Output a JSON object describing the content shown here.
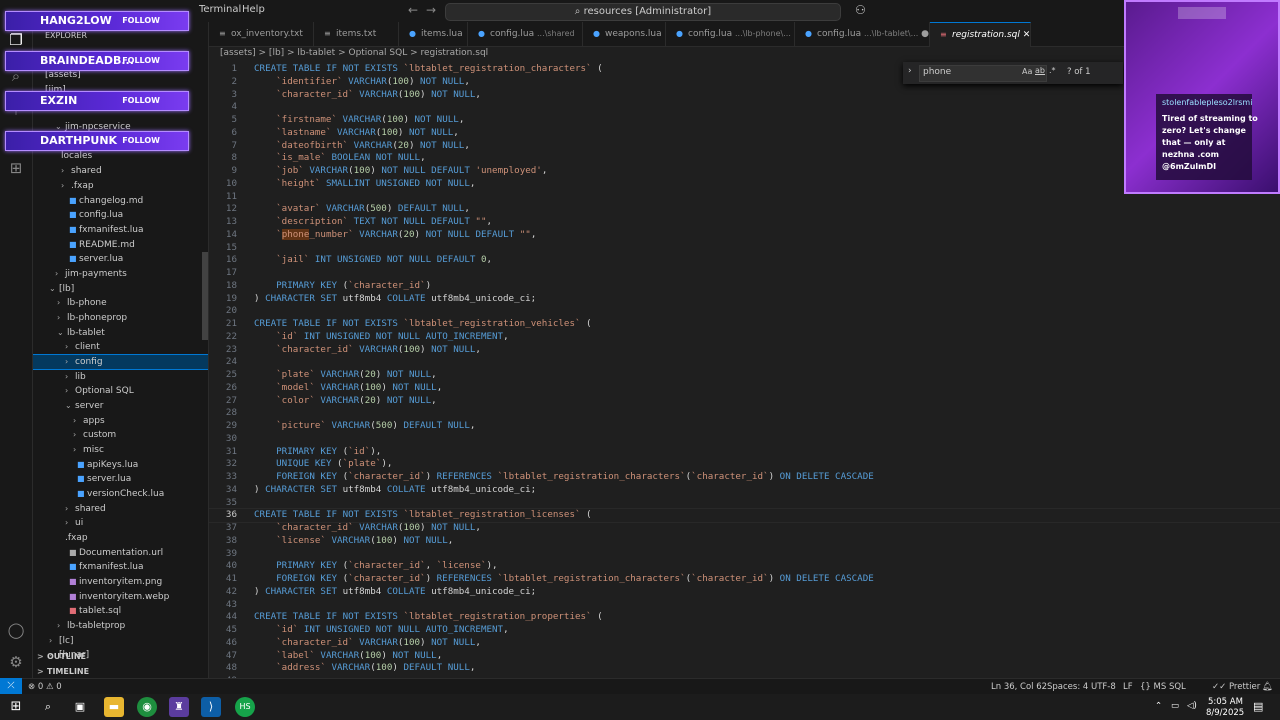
{
  "menu": {
    "terminal": "Terminal",
    "help": "Help"
  },
  "command_center": "resources [Administrator]",
  "follow_banners": [
    {
      "name": "HANG2LOW",
      "follow": "FOLLOW"
    },
    {
      "name": "BRAINDEADB...",
      "follow": "FOLLOW"
    },
    {
      "name": "EXZIN",
      "follow": "FOLLOW"
    },
    {
      "name": "DARTHPUNK",
      "follow": "FOLLOW"
    }
  ],
  "sidebar": {
    "title": "EXPLORER",
    "rows": [
      {
        "label": "[assets]",
        "icon": "",
        "chev": ""
      },
      {
        "label": "[jim]",
        "icon": "",
        "chev": ""
      },
      {
        "label": "jim-npcservice",
        "icon": "",
        "chev": "v"
      },
      {
        "label": "locales",
        "icon": "",
        "chev": ""
      },
      {
        "label": "shared",
        "icon": "",
        "chev": ">"
      },
      {
        "label": ".fxap",
        "icon": "",
        "chev": ">"
      },
      {
        "label": "changelog.md",
        "icon": "i",
        "chev": ""
      },
      {
        "label": "config.lua",
        "icon": "i",
        "chev": ""
      },
      {
        "label": "fxmanifest.lua",
        "icon": "i",
        "chev": ""
      },
      {
        "label": "README.md",
        "icon": "i",
        "chev": ""
      },
      {
        "label": "server.lua",
        "icon": "i",
        "chev": ""
      },
      {
        "label": "jim-payments",
        "icon": "",
        "chev": ">"
      },
      {
        "label": "[lb]",
        "icon": "",
        "chev": "v"
      },
      {
        "label": "lb-phone",
        "icon": "",
        "chev": ">"
      },
      {
        "label": "lb-phoneprop",
        "icon": "",
        "chev": ">"
      },
      {
        "label": "lb-tablet",
        "icon": "",
        "chev": "v"
      },
      {
        "label": "client",
        "icon": "",
        "chev": ">"
      },
      {
        "label": "config",
        "icon": "",
        "chev": ">"
      },
      {
        "label": "lib",
        "icon": "",
        "chev": ">"
      },
      {
        "label": "Optional SQL",
        "icon": "",
        "chev": ">"
      },
      {
        "label": "server",
        "icon": "",
        "chev": "v"
      },
      {
        "label": "apps",
        "icon": "",
        "chev": ">"
      },
      {
        "label": "custom",
        "icon": "",
        "chev": ">"
      },
      {
        "label": "misc",
        "icon": "",
        "chev": ">"
      },
      {
        "label": "apiKeys.lua",
        "icon": "i",
        "chev": ""
      },
      {
        "label": "server.lua",
        "icon": "i",
        "chev": ""
      },
      {
        "label": "versionCheck.lua",
        "icon": "i",
        "chev": ""
      },
      {
        "label": "shared",
        "icon": "",
        "chev": ">"
      },
      {
        "label": "ui",
        "icon": "",
        "chev": ">"
      },
      {
        "label": ".fxap",
        "icon": "",
        "chev": ""
      },
      {
        "label": "Documentation.url",
        "icon": "i",
        "chev": ""
      },
      {
        "label": "fxmanifest.lua",
        "icon": "i",
        "chev": ""
      },
      {
        "label": "inventoryitem.png",
        "icon": "i",
        "chev": ""
      },
      {
        "label": "inventoryitem.webp",
        "icon": "i",
        "chev": ""
      },
      {
        "label": "tablet.sql",
        "icon": "i",
        "chev": ""
      },
      {
        "label": "lb-tabletprop",
        "icon": "",
        "chev": ">"
      },
      {
        "label": "[lc]",
        "icon": "",
        "chev": ">"
      },
      {
        "label": "[lunar]",
        "icon": "",
        "chev": ">"
      }
    ],
    "outline": "OUTLINE",
    "timeline": "TIMELINE"
  },
  "tabs": [
    {
      "label": "ox_inventory.txt",
      "desc": ""
    },
    {
      "label": "items.txt",
      "desc": ""
    },
    {
      "label": "items.lua",
      "desc": ""
    },
    {
      "label": "config.lua",
      "desc": "...\\shared"
    },
    {
      "label": "weapons.lua",
      "desc": ""
    },
    {
      "label": "config.lua",
      "desc": "...\\lb-phone\\..."
    },
    {
      "label": "config.lua",
      "desc": "...\\lb-tablet\\..."
    },
    {
      "label": "registration.sql",
      "desc": ""
    }
  ],
  "breadcrumb": "[assets] > [lb] > lb-tablet > Optional SQL > registration.sql",
  "find": {
    "value": "phone",
    "result": "? of 1",
    "case": "Aa",
    "word": "ab",
    "regex": ".*"
  },
  "code": [
    "CREATE TABLE IF NOT EXISTS `lbtablet_registration_characters` (",
    "    `identifier` VARCHAR(100) NOT NULL,",
    "    `character_id` VARCHAR(100) NOT NULL,",
    "",
    "    `firstname` VARCHAR(100) NOT NULL,",
    "    `lastname` VARCHAR(100) NOT NULL,",
    "    `dateofbirth` VARCHAR(20) NOT NULL,",
    "    `is_male` BOOLEAN NOT NULL,",
    "    `job` VARCHAR(100) NOT NULL DEFAULT 'unemployed',",
    "    `height` SMALLINT UNSIGNED NOT NULL,",
    "",
    "    `avatar` VARCHAR(500) DEFAULT NULL,",
    "    `description` TEXT NOT NULL DEFAULT \"\",",
    "    `phone_number` VARCHAR(20) NOT NULL DEFAULT \"\",",
    "",
    "    `jail` INT UNSIGNED NOT NULL DEFAULT 0,",
    "",
    "    PRIMARY KEY (`character_id`)",
    ") CHARACTER SET utf8mb4 COLLATE utf8mb4_unicode_ci;",
    "",
    "CREATE TABLE IF NOT EXISTS `lbtablet_registration_vehicles` (",
    "    `id` INT UNSIGNED NOT NULL AUTO_INCREMENT,",
    "    `character_id` VARCHAR(100) NOT NULL,",
    "",
    "    `plate` VARCHAR(20) NOT NULL,",
    "    `model` VARCHAR(100) NOT NULL,",
    "    `color` VARCHAR(20) NOT NULL,",
    "",
    "    `picture` VARCHAR(500) DEFAULT NULL,",
    "",
    "    PRIMARY KEY (`id`),",
    "    UNIQUE KEY (`plate`),",
    "    FOREIGN KEY (`character_id`) REFERENCES `lbtablet_registration_characters`(`character_id`) ON DELETE CASCADE",
    ") CHARACTER SET utf8mb4 COLLATE utf8mb4_unicode_ci;",
    "",
    "CREATE TABLE IF NOT EXISTS `lbtablet_registration_licenses` (",
    "    `character_id` VARCHAR(100) NOT NULL,",
    "    `license` VARCHAR(100) NOT NULL,",
    "",
    "    PRIMARY KEY (`character_id`, `license`),",
    "    FOREIGN KEY (`character_id`) REFERENCES `lbtablet_registration_characters`(`character_id`) ON DELETE CASCADE",
    ") CHARACTER SET utf8mb4 COLLATE utf8mb4_unicode_ci;",
    "",
    "CREATE TABLE IF NOT EXISTS `lbtablet_registration_properties` (",
    "    `id` INT UNSIGNED NOT NULL AUTO_INCREMENT,",
    "    `character_id` VARCHAR(100) NOT NULL,",
    "    `label` VARCHAR(100) NOT NULL,",
    "    `address` VARCHAR(100) DEFAULT NULL,",
    ""
  ],
  "current_line": 36,
  "overlay": {
    "user": "stolenfablepleso2lrsmi",
    "lines": [
      "Tired of streaming to",
      "zero? Let's change",
      "that — only at",
      "nezhna .com",
      "@6mZulmDI"
    ]
  },
  "status": {
    "errors": "0",
    "warnings": "0",
    "position": "Ln 36, Col 62",
    "spaces": "Spaces: 4",
    "encoding": "UTF-8",
    "eol": "LF",
    "language": "MS SQL",
    "formatter": "Prettier"
  },
  "taskbar": {
    "time": "5:05 AM",
    "date": "8/9/2025"
  }
}
